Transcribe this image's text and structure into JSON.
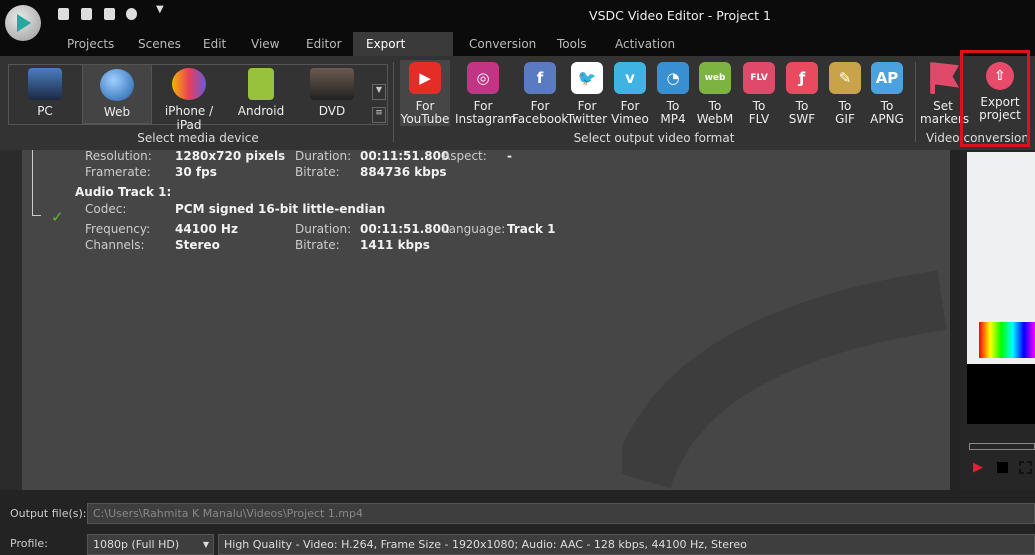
{
  "window": {
    "title": "VSDC Video Editor - Project 1"
  },
  "quick_icons": [
    "new-project-icon",
    "open-icon",
    "save-icon",
    "play-icon",
    "customize-icon"
  ],
  "tabs": [
    {
      "label": "Projects"
    },
    {
      "label": "Scenes"
    },
    {
      "label": "Edit"
    },
    {
      "label": "View"
    },
    {
      "label": "Editor"
    },
    {
      "label": "Export project",
      "active": true
    },
    {
      "label": "Conversion"
    },
    {
      "label": "Tools"
    },
    {
      "label": "Activation"
    }
  ],
  "devices": {
    "items": [
      {
        "label": "PC"
      },
      {
        "label": "Web",
        "selected": true
      },
      {
        "label": "iPhone / iPad"
      },
      {
        "label": "Android"
      },
      {
        "label": "DVD"
      }
    ],
    "group_label": "Select media device"
  },
  "formats": {
    "items": [
      {
        "l1": "For",
        "l2": "YouTube",
        "color": "#e52d27",
        "glyph": "▶"
      },
      {
        "l1": "For",
        "l2": "Instagram",
        "color": "#c13584",
        "glyph": "◎"
      },
      {
        "l1": "For",
        "l2": "Facebook",
        "color": "#5b7bc0",
        "glyph": "f"
      },
      {
        "l1": "For",
        "l2": "Twitter",
        "color": "#ffffff",
        "glyph": "🐦"
      },
      {
        "l1": "For",
        "l2": "Vimeo",
        "color": "#3fb4e3",
        "glyph": "v"
      },
      {
        "l1": "To",
        "l2": "MP4",
        "color": "#3a8fd0",
        "glyph": "◔"
      },
      {
        "l1": "To",
        "l2": "WebM",
        "color": "#7cb342",
        "glyph": "web"
      },
      {
        "l1": "To",
        "l2": "FLV",
        "color": "#e04a6a",
        "glyph": "FLV"
      },
      {
        "l1": "To",
        "l2": "SWF",
        "color": "#e84a5f",
        "glyph": "ƒ"
      },
      {
        "l1": "To",
        "l2": "GIF",
        "color": "#c9a34a",
        "glyph": "✎"
      },
      {
        "l1": "To",
        "l2": "APNG",
        "color": "#4aa3df",
        "glyph": "AP"
      }
    ],
    "group_label": "Select output video format"
  },
  "conversion": {
    "set_markers": [
      "Set",
      "markers"
    ],
    "export": [
      "Export",
      "project"
    ],
    "group_label": "Video conversion"
  },
  "info": {
    "resolution_label": "Resolution:",
    "resolution": "1280x720 pixels",
    "duration_label": "Duration:",
    "duration": "00:11:51.800",
    "aspect_label": "Aspect:",
    "aspect": "-",
    "framerate_label": "Framerate:",
    "framerate": "30 fps",
    "bitrate_label": "Bitrate:",
    "bitrate": "884736 kbps",
    "audio_title": "Audio Track 1:",
    "codec_label": "Codec:",
    "codec": "PCM signed 16-bit little-endian",
    "frequency_label": "Frequency:",
    "frequency": "44100 Hz",
    "a_duration_label": "Duration:",
    "a_duration": "00:11:51.800",
    "language_label": "Language:",
    "language": "Track 1",
    "channels_label": "Channels:",
    "channels": "Stereo",
    "a_bitrate_label": "Bitrate:",
    "a_bitrate": "1411 kbps"
  },
  "output": {
    "label": "Output file(s):",
    "value": "C:\\Users\\Rahmita K Manalu\\Videos\\Project 1.mp4"
  },
  "profile": {
    "label": "Profile:",
    "selected": "1080p (Full HD)",
    "description": "High Quality - Video: H.264, Frame Size - 1920x1080; Audio: AAC - 128 kbps, 44100 Hz, Stereo"
  }
}
